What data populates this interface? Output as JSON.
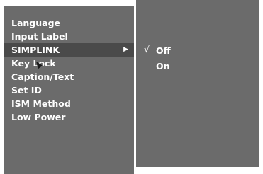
{
  "menu": {
    "items": [
      {
        "label": "Language"
      },
      {
        "label": "Input Label"
      },
      {
        "label": "SIMPLINK",
        "selected": true,
        "has_submenu": true
      },
      {
        "label": "Key Lock"
      },
      {
        "label": "Caption/Text"
      },
      {
        "label": "Set ID"
      },
      {
        "label": "ISM Method"
      },
      {
        "label": "Low Power"
      }
    ],
    "submenu_arrow": "▶"
  },
  "submenu": {
    "options": [
      {
        "label": "Off",
        "checked": true
      },
      {
        "label": "On",
        "checked": false
      }
    ],
    "check_mark": "√"
  },
  "colors": {
    "panel_background": "#6b6b6b",
    "selected_background": "#4a4a4a",
    "text": "#ffffff"
  },
  "icons": {
    "submenu_arrow": "triangle-right-icon",
    "check": "check-icon",
    "pointer": "mouse-cursor-icon"
  }
}
